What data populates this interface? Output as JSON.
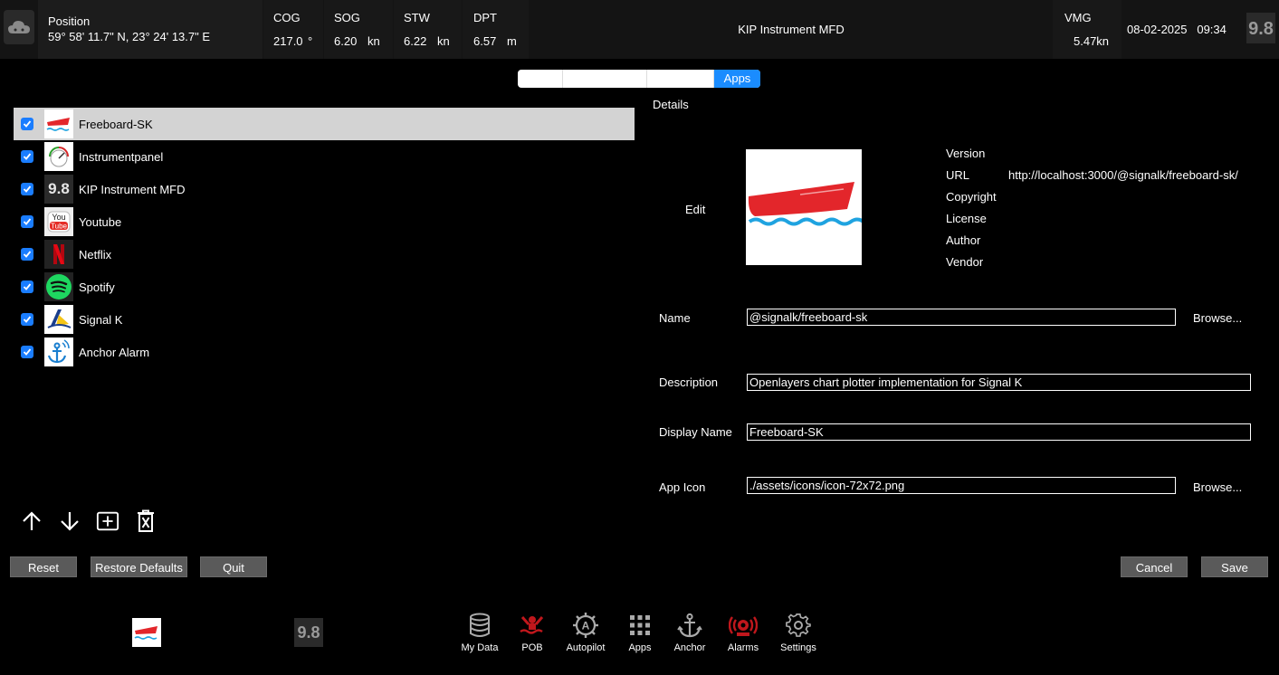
{
  "topbar": {
    "position": {
      "label": "Position",
      "value": "59° 58' 11.7\" N, 23° 24' 13.7\" E"
    },
    "cog": {
      "label": "COG",
      "value": "217.0",
      "unit": "°"
    },
    "sog": {
      "label": "SOG",
      "value": "6.20",
      "unit": "kn"
    },
    "stw": {
      "label": "STW",
      "value": "6.22",
      "unit": "kn"
    },
    "dpt": {
      "label": "DPT",
      "value": "6.57",
      "unit": "m"
    },
    "title": "KIP Instrument MFD",
    "vmg": {
      "label": "VMG",
      "value": "5.47kn"
    },
    "date": "08-02-2025",
    "time": "09:34",
    "kip_icon_text": "9.8"
  },
  "segments": [
    {
      "label": ""
    },
    {
      "label": ""
    },
    {
      "label": ""
    },
    {
      "label": "Apps"
    }
  ],
  "apps": [
    {
      "name": "Freeboard-SK",
      "icon": "freeboard-icon",
      "checked": true,
      "selected": true
    },
    {
      "name": "Instrumentpanel",
      "icon": "instrumentpanel-icon",
      "checked": true
    },
    {
      "name": "KIP Instrument MFD",
      "icon": "kip-icon",
      "checked": true
    },
    {
      "name": "Youtube",
      "icon": "youtube-icon",
      "checked": true
    },
    {
      "name": "Netflix",
      "icon": "netflix-icon",
      "checked": true
    },
    {
      "name": "Spotify",
      "icon": "spotify-icon",
      "checked": true
    },
    {
      "name": "Signal K",
      "icon": "signalk-icon",
      "checked": true
    },
    {
      "name": "Anchor Alarm",
      "icon": "anchor-alarm-icon",
      "checked": true
    }
  ],
  "buttons": {
    "reset": "Reset",
    "restore": "Restore Defaults",
    "quit": "Quit",
    "cancel": "Cancel",
    "save": "Save"
  },
  "details": {
    "title": "Details",
    "edit": "Edit",
    "meta": {
      "version_label": "Version",
      "url_label": "URL",
      "url_value": "http://localhost:3000/@signalk/freeboard-sk/",
      "copyright_label": "Copyright",
      "license_label": "License",
      "author_label": "Author",
      "vendor_label": "Vendor"
    },
    "name_label": "Name",
    "name_value": "@signalk/freeboard-sk",
    "description_label": "Description",
    "description_value": "Openlayers chart plotter implementation for Signal K",
    "display_name_label": "Display Name",
    "display_name_value": "Freeboard-SK",
    "app_icon_label": "App Icon",
    "app_icon_value": "./assets/icons/icon-72x72.png",
    "browse": "Browse..."
  },
  "dock": [
    {
      "label": "My Data",
      "icon": "database-icon"
    },
    {
      "label": "POB",
      "icon": "pob-icon",
      "color": "#c0171c"
    },
    {
      "label": "Autopilot",
      "icon": "autopilot-icon"
    },
    {
      "label": "Apps",
      "icon": "apps-grid-icon"
    },
    {
      "label": "Anchor",
      "icon": "anchor-icon"
    },
    {
      "label": "Alarms",
      "icon": "alarm-icon",
      "color": "#c0171c"
    },
    {
      "label": "Settings",
      "icon": "gear-icon"
    }
  ]
}
